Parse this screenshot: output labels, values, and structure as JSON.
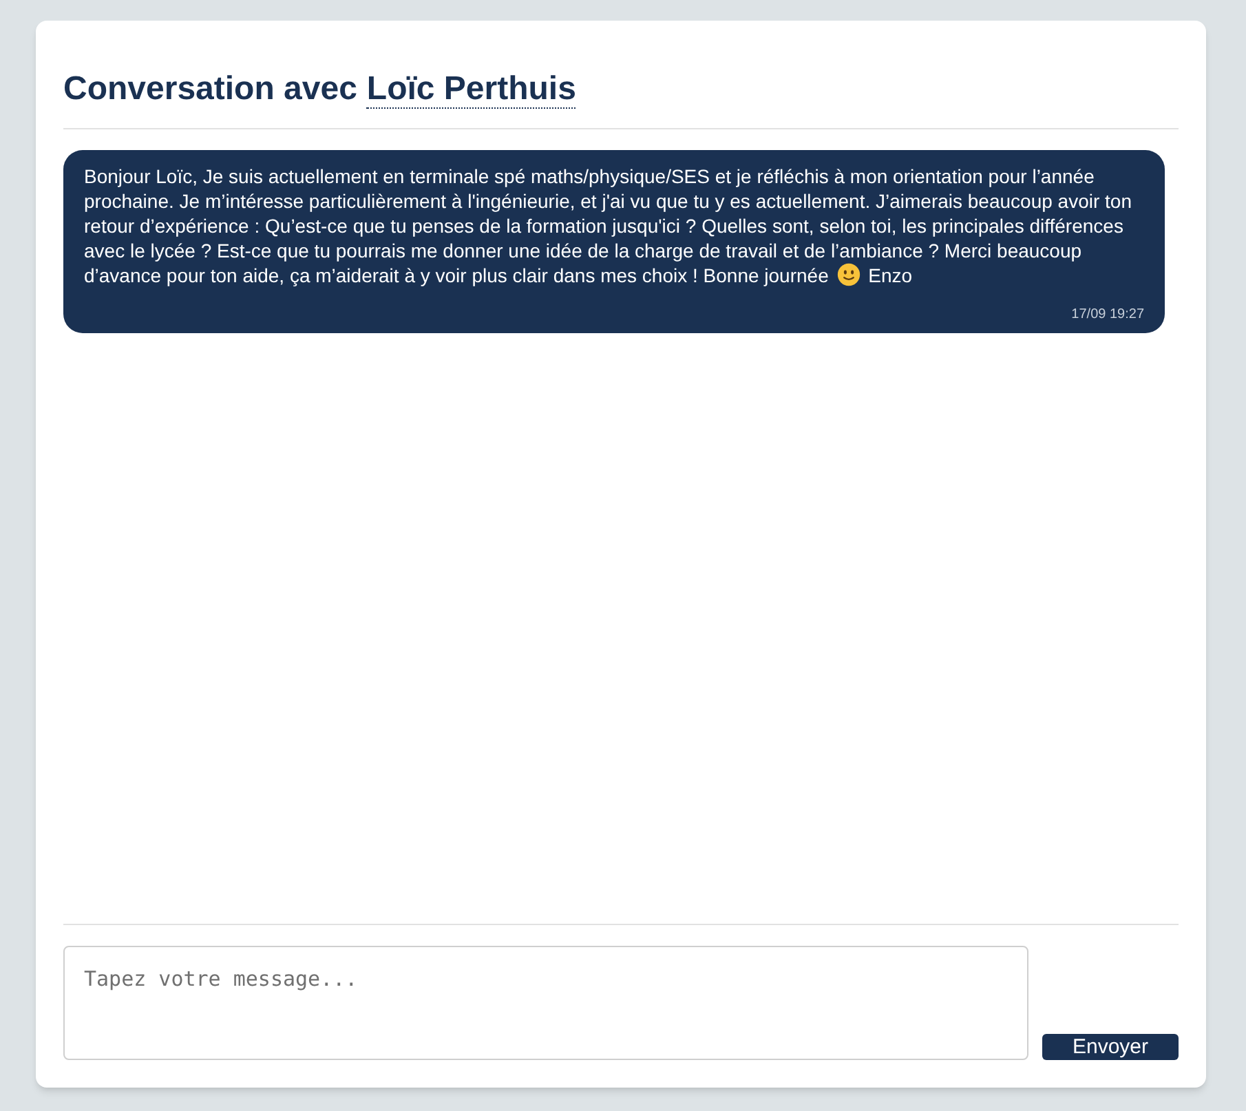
{
  "header": {
    "prefix": "Conversation avec",
    "contact_name": "Loïc Perthuis"
  },
  "messages": [
    {
      "text_before_icon": "Bonjour Loïc, Je suis actuellement en terminale spé maths/physique/SES et je réfléchis à mon orientation pour l’année prochaine. Je m’intéresse particulièrement à l'ingénieurie, et j'ai vu que tu y es actuellement. J’aimerais beaucoup avoir ton retour d’expérience : Qu’est-ce que tu penses de la formation jusqu'ici ? Quelles sont, selon toi, les principales différences avec le lycée ? Est-ce que tu pourrais me donner une idée de la charge de travail et de l’ambiance ? Merci beaucoup d’avance pour ton aide, ça m’aiderait à y voir plus clair dans mes choix ! Bonne journée",
      "text_after_icon": "Enzo",
      "time": "17/09 19:27"
    }
  ],
  "composer": {
    "placeholder": "Tapez votre message...",
    "send_label": "Envoyer"
  }
}
